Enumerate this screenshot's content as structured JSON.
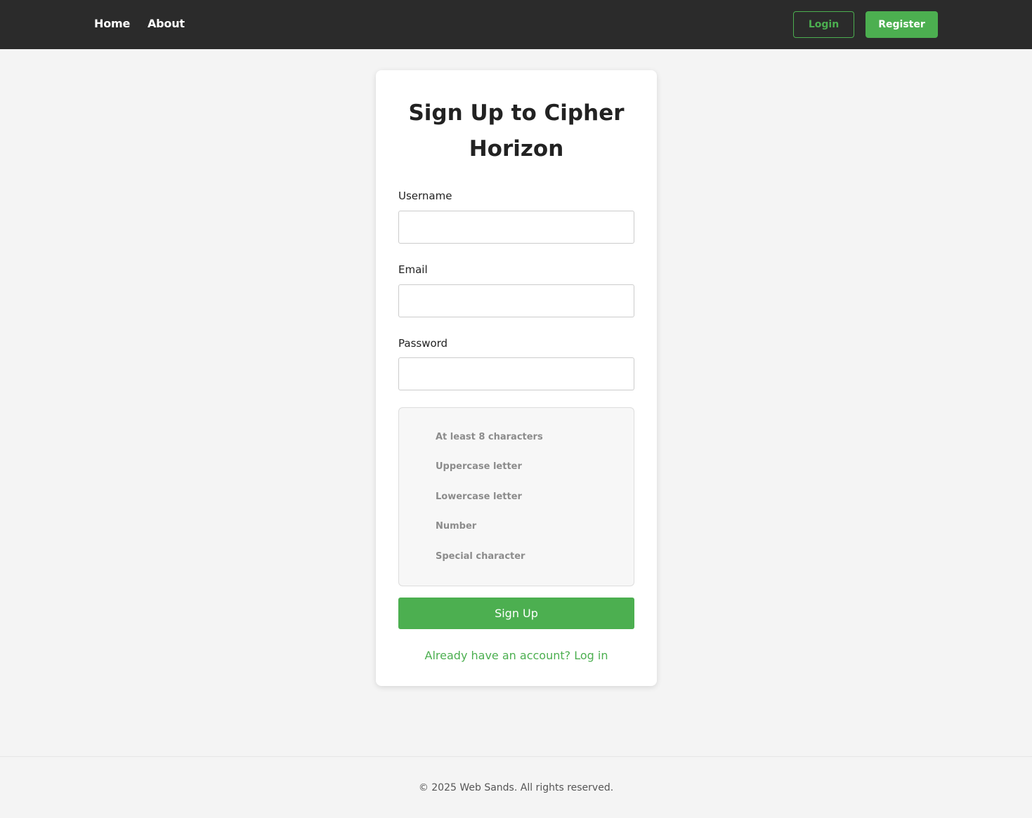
{
  "nav": {
    "home_label": "Home",
    "about_label": "About",
    "login_label": "Login",
    "register_label": "Register"
  },
  "signup": {
    "title": "Sign Up to Cipher Horizon",
    "username_label": "Username",
    "username_value": "",
    "email_label": "Email",
    "email_value": "",
    "password_label": "Password",
    "password_value": "",
    "requirements": [
      "At least 8 characters",
      "Uppercase letter",
      "Lowercase letter",
      "Number",
      "Special character"
    ],
    "submit_label": "Sign Up",
    "login_link": "Already have an account? Log in"
  },
  "footer": {
    "text": "© 2025 Web Sands. All rights reserved."
  },
  "colors": {
    "accent": "#4caf50",
    "navbar_bg": "#2b2b2b",
    "page_bg": "#f4f4f4"
  }
}
